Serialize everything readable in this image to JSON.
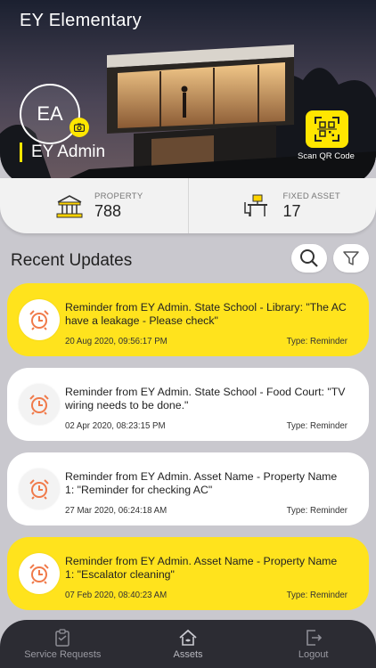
{
  "header": {
    "title": "EY Elementary",
    "avatar_initials": "EA",
    "user_name": "EY Admin",
    "qr_label": "Scan QR Code"
  },
  "stats": [
    {
      "label": "PROPERTY",
      "value": "788",
      "icon": "building-icon"
    },
    {
      "label": "FIXED ASSET",
      "value": "17",
      "icon": "desk-chair-icon"
    }
  ],
  "recent": {
    "title": "Recent Updates",
    "items": [
      {
        "message": "Reminder from EY Admin. State School - Library: \"The AC have a leakage - Please check\"",
        "date": "20 Aug 2020, 09:56:17 PM",
        "type": "Type: Reminder",
        "style": "yellow"
      },
      {
        "message": "Reminder from EY Admin. State School - Food Court: \"TV wiring needs to be done.\"",
        "date": "02 Apr 2020, 08:23:15 PM",
        "type": "Type: Reminder",
        "style": "white"
      },
      {
        "message": "Reminder from EY Admin. Asset Name - Property Name 1: \"Reminder for checking AC\"",
        "date": "27 Mar 2020, 06:24:18 AM",
        "type": "Type: Reminder",
        "style": "white"
      },
      {
        "message": "Reminder from EY Admin. Asset Name - Property Name 1: \"Escalator cleaning\"",
        "date": "07 Feb 2020, 08:40:23 AM",
        "type": "Type: Reminder",
        "style": "yellow"
      }
    ]
  },
  "nav": {
    "service_requests": "Service Requests",
    "assets": "Assets",
    "logout": "Logout"
  },
  "colors": {
    "accent": "#ffe31d",
    "nav_bg": "#2c2c33",
    "page_bg": "#c9c8ce"
  }
}
